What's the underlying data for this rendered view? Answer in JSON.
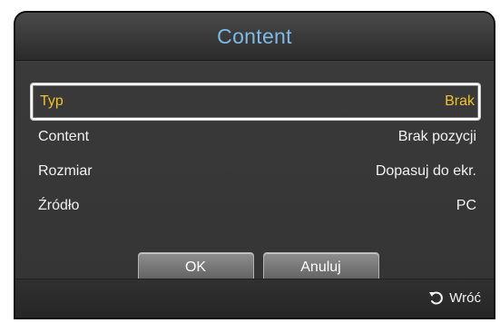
{
  "dialog": {
    "title": "Content",
    "rows": [
      {
        "label": "Typ",
        "value": "Brak"
      },
      {
        "label": "Content",
        "value": "Brak pozycji"
      },
      {
        "label": "Rozmiar",
        "value": "Dopasuj do ekr."
      },
      {
        "label": "Źródło",
        "value": "PC"
      }
    ],
    "buttons": {
      "ok": "OK",
      "cancel": "Anuluj"
    },
    "footer": {
      "return_label": "Wróć",
      "return_icon": "return-arrow-icon"
    }
  },
  "colors": {
    "title": "#7fb9e6",
    "selected_text": "#f0c12a",
    "panel": "#383838",
    "text": "#f1f1f1"
  }
}
